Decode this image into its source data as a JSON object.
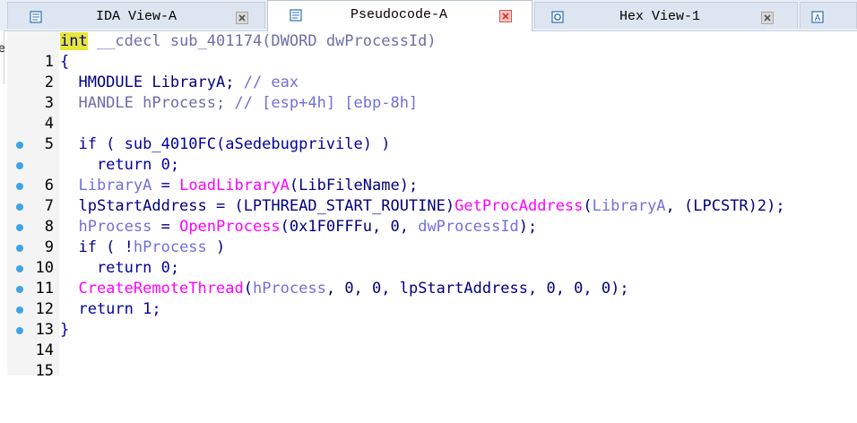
{
  "tabs": [
    {
      "label": "IDA View-A",
      "active": false,
      "icon": "disassembly-view-icon"
    },
    {
      "label": "Pseudocode-A",
      "active": true,
      "icon": "pseudocode-view-icon"
    },
    {
      "label": "Hex View-1",
      "active": false,
      "icon": "hex-view-icon"
    },
    {
      "label": "",
      "active": false,
      "icon": "structures-view-icon",
      "icon_glyph": "A"
    }
  ],
  "left_edge_char": "e",
  "code": {
    "lines": [
      {
        "n": "1"
      },
      {
        "n": "2"
      },
      {
        "n": "3"
      },
      {
        "n": "4"
      },
      {
        "n": "5"
      },
      {
        "n": "6"
      },
      {
        "n": "7"
      },
      {
        "n": "8"
      },
      {
        "n": "9"
      },
      {
        "n": "10"
      },
      {
        "n": "11"
      },
      {
        "n": "12"
      },
      {
        "n": "13"
      },
      {
        "n": "14"
      },
      {
        "n": "15"
      }
    ],
    "t": {
      "l1_int": "int",
      "l1_rest": " __cdecl sub_401174(DWORD dwProcessId)",
      "l2": "{",
      "l3_a": "  HMODULE LibraryA; ",
      "l3_c": "// eax",
      "l4_a": "  HANDLE hProcess; ",
      "l4_c": "// [esp+4h] [ebp-8h]",
      "l6_a": "  if ( sub_4010FC(aSedebugprivile) )",
      "l7": "    return 0;",
      "l8_v": "  LibraryA",
      "l8_eq": " = ",
      "l8_f": "LoadLibraryA",
      "l8_r": "(LibFileName);",
      "l9_a": "  lpStartAddress = (LPTHREAD_START_ROUTINE)",
      "l9_f": "GetProcAddress",
      "l9_p": "(",
      "l9_v": "LibraryA",
      "l9_r": ", (LPCSTR)2);",
      "l10_v": "  hProcess",
      "l10_eq": " = ",
      "l10_f": "OpenProcess",
      "l10_p": "(0x1F0FFFu, 0, ",
      "l10_v2": "dwProcessId",
      "l10_r": ");",
      "l11_a": "  if ( !",
      "l11_v": "hProcess",
      "l11_r": " )",
      "l12": "    return 0;",
      "l13_f": "  CreateRemoteThread",
      "l13_p": "(",
      "l13_v": "hProcess",
      "l13_r": ", 0, 0, lpStartAddress, 0, 0, 0);",
      "l14": "  return 1;",
      "l15": "}"
    },
    "breakpoint_lines": [
      "6",
      "7",
      "8",
      "9",
      "10",
      "11",
      "12",
      "13",
      "14",
      "15"
    ]
  },
  "colors": {
    "keyword_highlight": "#e6e63a",
    "function_name": "#ff00ff",
    "variable": "#7070d8",
    "comment": "#6e6ea8",
    "default_text": "#000080",
    "breakpoint_dot": "#3fa3e8"
  }
}
